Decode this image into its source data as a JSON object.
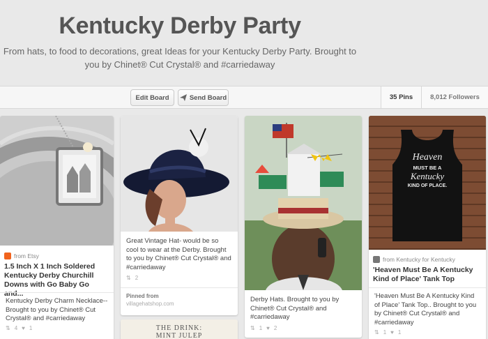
{
  "board": {
    "title": "Kentucky Derby Party",
    "description": "From hats, to food to decorations, great Ideas for your Kentucky Derby Party. Brought to you by Chinet® Cut Crystal® and #carriedaway"
  },
  "toolbar": {
    "edit_label": "Edit Board",
    "send_label": "Send Board",
    "pins_label": "35 Pins",
    "followers_label": "8,012 Followers"
  },
  "pins": [
    {
      "source": "from Etsy",
      "title": "1.5 Inch X 1 Inch Soldered Kentucky Derby Churchill Downs with Go Baby Go and...",
      "caption": "Kentucky Derby Charm Necklace-- Brought to you by Chinet® Cut Crystal® and #carriedaway",
      "repins": "4",
      "likes": "1"
    },
    {
      "caption": "Great Vintage Hat- would be so cool to wear at the Derby. Brought to you by Chinet® Cut Crystal® and #carriedaway",
      "repins": "2",
      "pinned_from_label": "Pinned from",
      "pinned_from_url": "villagehatshop.com"
    },
    {
      "caption": "Derby Hats. Brought to you by Chinet® Cut Crystal® and #carriedaway",
      "repins": "1",
      "likes": "2"
    },
    {
      "source": "from Kentucky for Kentucky",
      "title": "'Heaven Must Be A Kentucky Kind of Place' Tank Top",
      "caption": "'Heaven Must Be A Kentucky Kind of Place' Tank Top.. Brought to you by Chinet® Cut Crystal® and #carriedaway",
      "repins": "1",
      "likes": "1",
      "shirt_text": [
        "Heaven",
        "MUST BE A",
        "Kentucky",
        "KIND OF PLACE."
      ]
    },
    {
      "image_text": [
        "THE DRINK:",
        "MINT JULEP"
      ]
    }
  ],
  "colors": {
    "background": "#e9e9e9",
    "etsy": "#f1641e",
    "title_text": "#555555"
  }
}
